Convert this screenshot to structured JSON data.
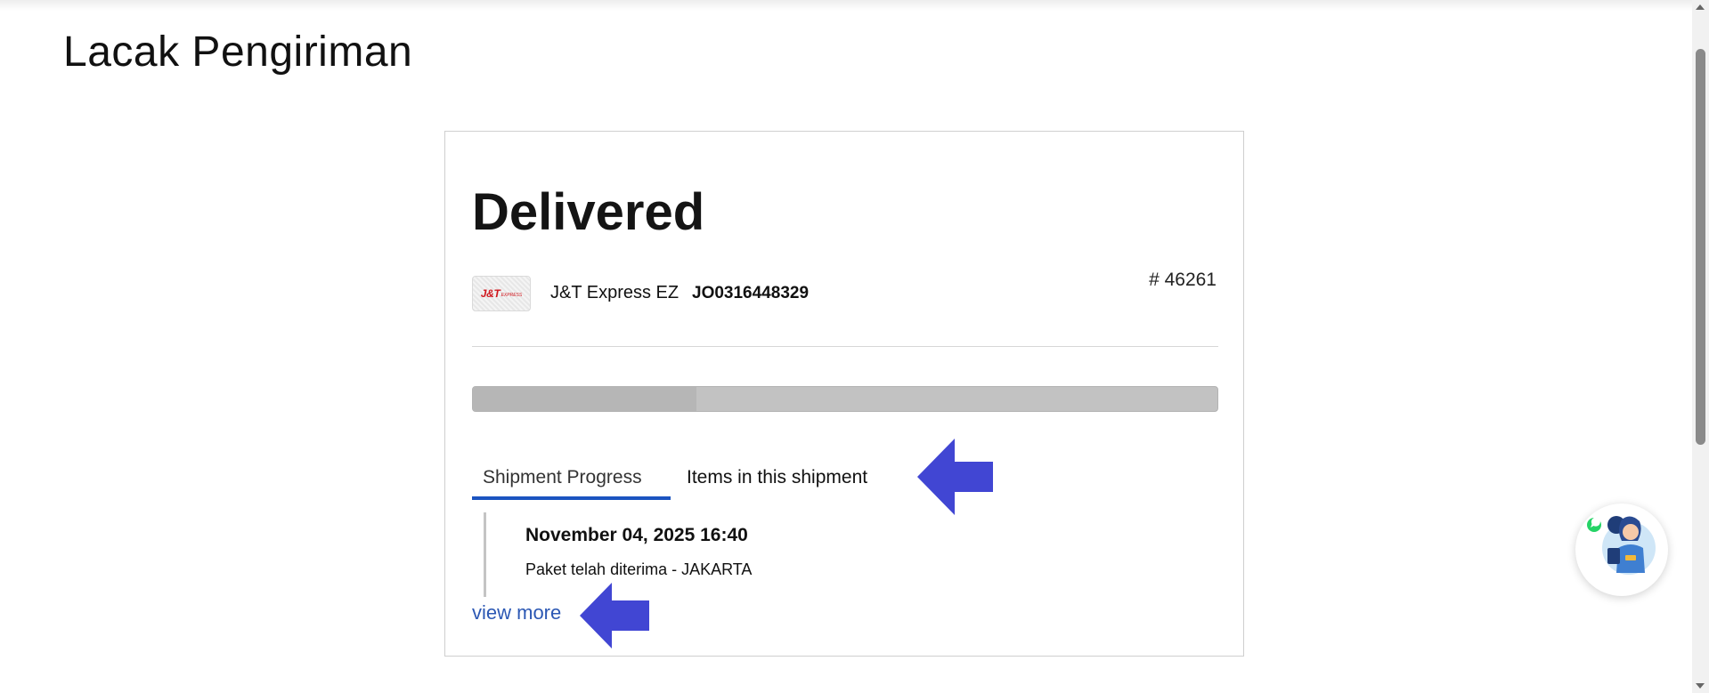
{
  "page": {
    "title": "Lacak Pengiriman"
  },
  "shipment": {
    "status": "Delivered",
    "carrier": {
      "logo_text": "J&T",
      "logo_subtext": "EXPRESS",
      "name": "J&T Express EZ",
      "tracking_number": "JO0316448329"
    },
    "order_number": "# 46261",
    "progress_fraction": 0.3
  },
  "tabs": [
    {
      "label": "Shipment Progress",
      "active": true
    },
    {
      "label": "Items in this shipment",
      "active": false
    }
  ],
  "events": [
    {
      "date": "November 04, 2025 16:40",
      "description": "Paket telah diterima - JAKARTA"
    }
  ],
  "view_more_label": "view more",
  "colors": {
    "accent": "#1b54c0",
    "link": "#2c58b4",
    "annotation_arrow": "#4146d3"
  },
  "icons": {
    "chat_widget": "customer-support-whatsapp-icon",
    "annotation": "left-arrow-icon"
  }
}
